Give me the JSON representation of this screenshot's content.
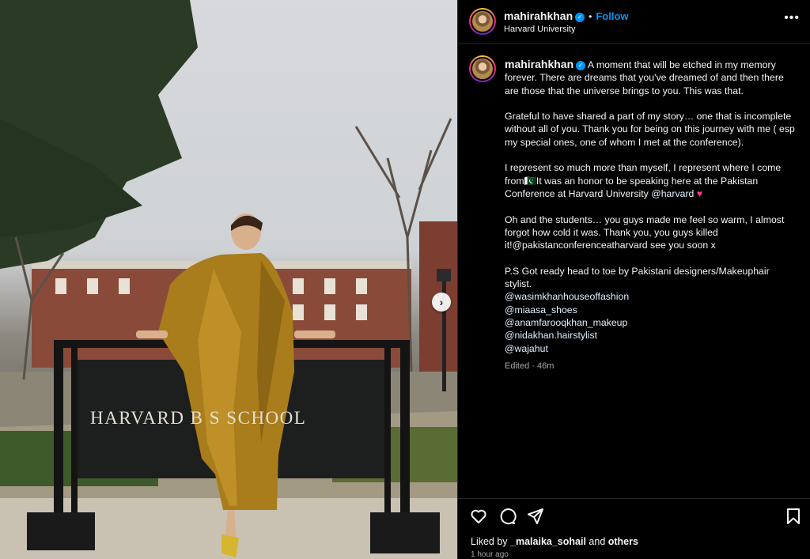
{
  "post": {
    "username": "mahirahkhan",
    "verified_mark": "✓",
    "follow_label": "Follow",
    "location": "Harvard University",
    "more_label": "•••",
    "sign_text": "HARVARD B      S SCHOOL",
    "next_label": "›"
  },
  "caption": {
    "username": "mahirahkhan",
    "p1": "A moment that will be etched in my memory forever. There are dreams that you've dreamed of and then there are those that the universe brings to you. This was that.",
    "p2": "Grateful to have shared a part of my story… one that is incomplete without all of you. Thank you for being on this journey with me ( esp my special ones, one of whom I met at the conference).",
    "p3_text": "I represent so much more than myself, I represent where I come from🇵🇰It was an honor to be speaking here at the Pakistan Conference at Harvard University",
    "p3_mention": "@harvard",
    "p3_heart": "♥",
    "p4": "Oh and the students… you guys made me feel so warm, I almost forgot how cold it was. Thank you, you guys killed it!@pakistanconferenceatharvard see you soon x",
    "p5": "P.S Got ready head to toe by Pakistani designers/Makeuphair stylist.",
    "links": [
      "@wasimkhanhouseoffashion",
      "@miaasa_shoes",
      "@anamfarooqkhan_makeup",
      "@nidakhan.hairstylist",
      "@wajahut"
    ],
    "edited": "Edited · 46m"
  },
  "footer": {
    "liked_prefix": "Liked by ",
    "liked_user": "_malaika_sohail",
    "liked_and": " and ",
    "liked_others": "others",
    "time": "1 hour ago"
  },
  "icons": [
    "heart-icon",
    "comment-icon",
    "share-icon",
    "bookmark-icon",
    "chevron-right-icon",
    "more-icon",
    "verified-icon"
  ],
  "colors": {
    "accent": "#0095f6",
    "background": "#000000",
    "heart": "#ff3b84"
  }
}
